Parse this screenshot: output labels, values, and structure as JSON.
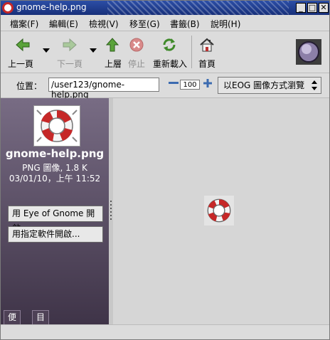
{
  "window": {
    "title": "gnome-help.png",
    "controls": {
      "minimize": "_",
      "maximize": "□",
      "close": "✕"
    }
  },
  "menubar": {
    "items": [
      "檔案(F)",
      "編輯(E)",
      "檢視(V)",
      "移至(G)",
      "書籤(B)",
      "說明(H)"
    ]
  },
  "toolbar": {
    "back": "上一頁",
    "forward": "下一頁",
    "up": "上層",
    "stop": "停止",
    "reload": "重新載入",
    "home": "首頁"
  },
  "location": {
    "label": "位置：",
    "value": "/user123/gnome-help.png",
    "zoom": "100",
    "viewer": "以EOG 圖像方式瀏覽"
  },
  "sidebar": {
    "filename": "gnome-help.png",
    "type": "PNG 圖像, 1.8 K",
    "date": "03/01/10，上午 11:52",
    "open_eog": "用 Eye of Gnome 開啟",
    "open_with": "用指定軟件開啟...",
    "tabs": [
      "便條",
      "目錄樹"
    ]
  },
  "status": {
    "text": ""
  },
  "colors": {
    "titlebar": "#2c4ea6",
    "sidebar_top": "#786c84",
    "sidebar_bottom": "#3f3448",
    "content_bg": "#d6d6d6"
  }
}
